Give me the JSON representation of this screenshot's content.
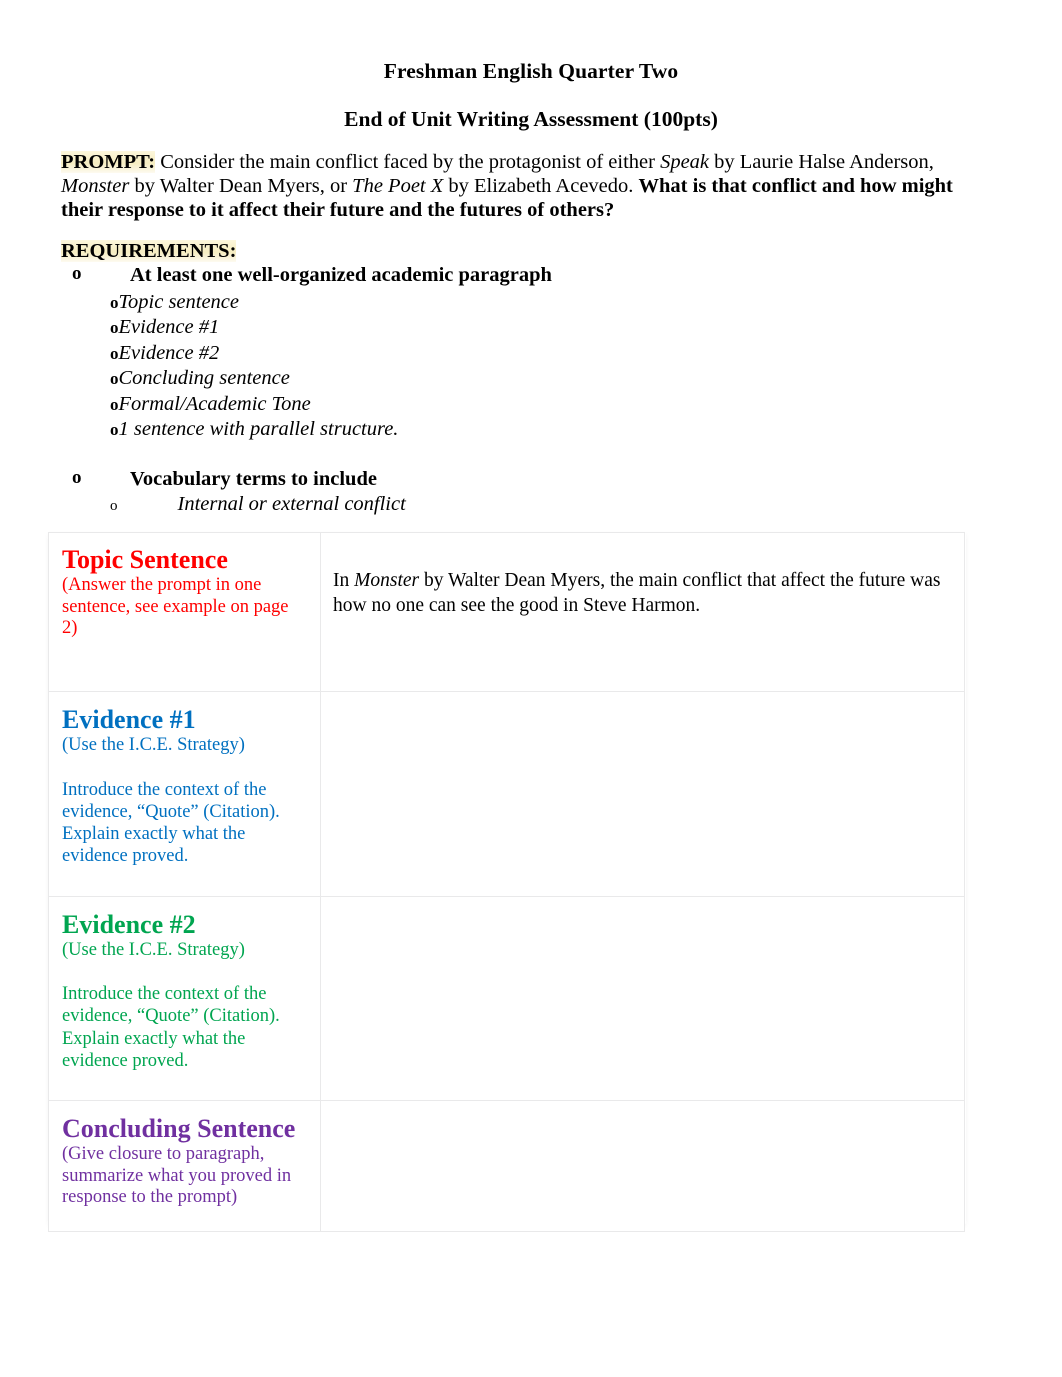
{
  "document": {
    "title": "Freshman English Quarter Two",
    "subtitle": "End of Unit Writing Assessment (100pts)"
  },
  "prompt": {
    "label": "PROMPT:",
    "text_part1": " Consider the main conflict faced by the protagonist of either ",
    "book1": "Speak",
    "text_part2": " by Laurie Halse Anderson, ",
    "book2": "Monster",
    "text_part3": " by Walter Dean Myers, or ",
    "book3": "The Poet X",
    "text_part4": " by Elizabeth Acevedo. ",
    "bold_question": "What is that conflict and how might their response to it affect their future and the futures of others?"
  },
  "requirements": {
    "label": "REQUIREMENTS:",
    "items": [
      {
        "bullet": "o",
        "label": "At least one well-organized academic paragraph",
        "subitems": [
          {
            "bullet": "o",
            "label": "Topic sentence"
          },
          {
            "bullet": "o",
            "label": "Evidence #1"
          },
          {
            "bullet": "o",
            "label": "Evidence #2"
          },
          {
            "bullet": "o",
            "label": "Concluding sentence"
          },
          {
            "bullet": "o",
            "label": "Formal/Academic Tone"
          },
          {
            "bullet": "o",
            "label": "1 sentence with parallel structure."
          }
        ]
      },
      {
        "bullet": "o",
        "label": "Vocabulary terms to include",
        "subitems": [
          {
            "bullet": "o",
            "label": "Internal or external conflict"
          }
        ]
      }
    ]
  },
  "table": {
    "rows": [
      {
        "heading": "Topic Sentence",
        "subheading": "(Answer the prompt in one sentence, see example on page 2)",
        "body": "",
        "color": "#FF0000",
        "answer_pre": "In ",
        "answer_italic": "Monster",
        "answer_post": " by Walter Dean Myers, the main conflict that affect the future was how no one can see the good in Steve Harmon."
      },
      {
        "heading": "Evidence #1",
        "subheading": "(Use the I.C.E. Strategy)",
        "body": "Introduce the context of the evidence, “Quote” (Citation). Explain exactly what the evidence proved.",
        "color": "#0070C0",
        "answer": ""
      },
      {
        "heading": "Evidence #2",
        "subheading": "(Use the I.C.E. Strategy)",
        "body": "Introduce the context of the evidence, “Quote” (Citation). Explain exactly what the evidence proved.",
        "color": "#00A550",
        "answer": ""
      },
      {
        "heading": "Concluding Sentence",
        "subheading": "(Give closure to paragraph, summarize what you proved in response to the prompt)",
        "body": "",
        "color": "#7030A0",
        "answer": ""
      }
    ]
  },
  "colors": {
    "topic": "#FF0000",
    "evidence1": "#0070C0",
    "evidence2": "#00A550",
    "concluding": "#7030A0",
    "highlight": "#F6EDC0",
    "table_border": "#E9E9EA"
  }
}
